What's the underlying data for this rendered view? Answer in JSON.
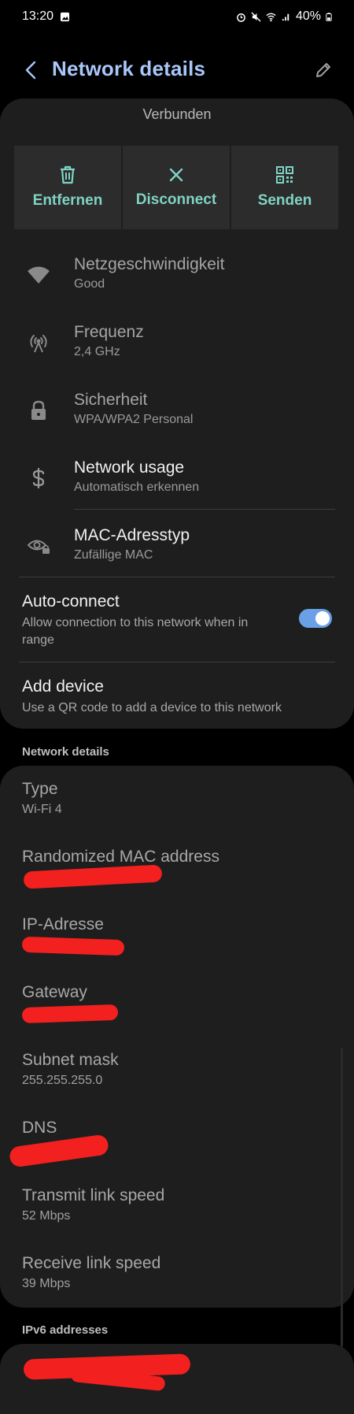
{
  "status_bar": {
    "time": "13:20",
    "battery": "40%"
  },
  "header": {
    "title": "Network details"
  },
  "main": {
    "status": "Verbunden",
    "actions": [
      {
        "label": "Entfernen",
        "icon": "trash-icon"
      },
      {
        "label": "Disconnect",
        "icon": "close-icon"
      },
      {
        "label": "Senden",
        "icon": "qr-code-icon"
      }
    ],
    "rows": [
      {
        "title": "Netzgeschwindigkeit",
        "sub": "Good",
        "icon": "wifi-icon"
      },
      {
        "title": "Frequenz",
        "sub": "2,4 GHz",
        "icon": "antenna-icon"
      },
      {
        "title": "Sicherheit",
        "sub": "WPA/WPA2 Personal",
        "icon": "lock-icon"
      },
      {
        "title": "Network usage",
        "sub": "Automatisch erkennen",
        "icon": "dollar-icon"
      },
      {
        "title": "MAC-Adresstyp",
        "sub": "Zufällige MAC",
        "icon": "eye-lock-icon"
      }
    ],
    "auto_connect": {
      "title": "Auto-connect",
      "sub": "Allow connection to this network when in range",
      "enabled": true
    },
    "add_device": {
      "title": "Add device",
      "sub": "Use a QR code to add a device to this network"
    }
  },
  "details_section": {
    "header": "Network details",
    "items": [
      {
        "title": "Type",
        "value": "Wi-Fi 4"
      },
      {
        "title": "Randomized MAC address",
        "value": ""
      },
      {
        "title": "IP-Adresse",
        "value": ""
      },
      {
        "title": "Gateway",
        "value": ""
      },
      {
        "title": "Subnet mask",
        "value": "255.255.255.0"
      },
      {
        "title": "DNS",
        "value": ""
      },
      {
        "title": "Transmit link speed",
        "value": "52 Mbps"
      },
      {
        "title": "Receive link speed",
        "value": "39 Mbps"
      }
    ]
  },
  "ipv6_section": {
    "header": "IPv6 addresses"
  },
  "colors": {
    "accent_title": "#a8c7fa",
    "action_teal": "#7fd3c5",
    "toggle_blue": "#6aa1e6",
    "redaction": "#f2201e"
  }
}
